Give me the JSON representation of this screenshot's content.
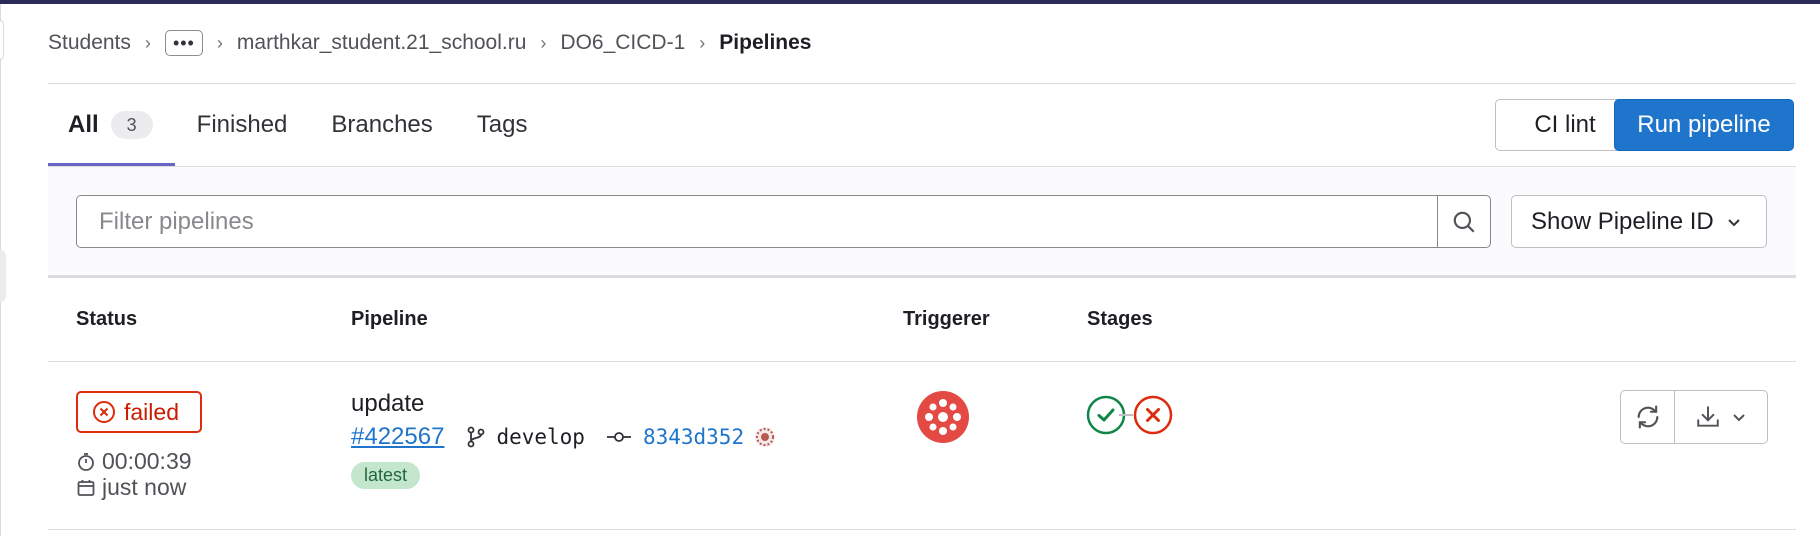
{
  "breadcrumb": {
    "items": [
      "Students",
      "…",
      "marthkar_student.21_school.ru",
      "DO6_CICD-1"
    ],
    "current": "Pipelines",
    "more_label": "•••"
  },
  "tabs": [
    {
      "label": "All",
      "count": "3",
      "active": true
    },
    {
      "label": "Finished"
    },
    {
      "label": "Branches"
    },
    {
      "label": "Tags"
    }
  ],
  "toolbar": {
    "ci_lint": "CI lint",
    "run_pipeline": "Run pipeline"
  },
  "filter": {
    "placeholder": "Filter pipelines",
    "show_id": "Show Pipeline ID"
  },
  "table": {
    "headers": {
      "status": "Status",
      "pipeline": "Pipeline",
      "triggerer": "Triggerer",
      "stages": "Stages"
    },
    "rows": [
      {
        "status": "failed",
        "duration": "00:00:39",
        "finished": "just now",
        "title": "update",
        "id": "#422567",
        "branch": "develop",
        "commit": "8343d352",
        "badge": "latest",
        "stages": [
          "passed",
          "failed"
        ]
      }
    ]
  },
  "colors": {
    "primary": "#1f75cb",
    "danger": "#dd2b0e",
    "success": "#108548",
    "tab_indicator": "#6666c4"
  },
  "icons": [
    "chevron-right-icon",
    "ellipsis-icon",
    "search-icon",
    "chevron-down-icon",
    "status-failed-icon",
    "timer-icon",
    "calendar-icon",
    "branch-icon",
    "commit-icon",
    "retry-icon",
    "download-icon"
  ]
}
